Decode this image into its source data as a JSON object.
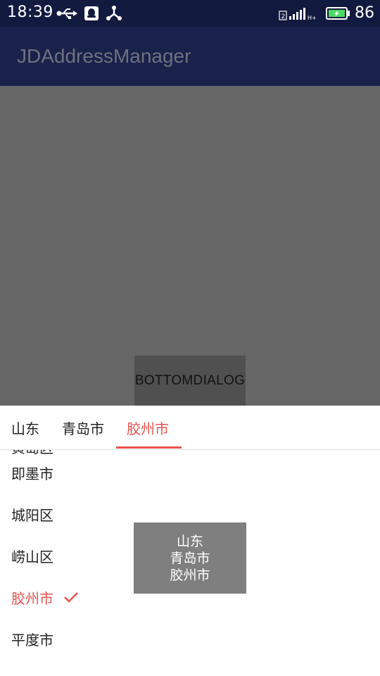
{
  "status_bar": {
    "time": "18:39",
    "battery_percent": "86",
    "icons": [
      "usb-icon",
      "qq-icon",
      "share-icon",
      "signal-icon",
      "battery-icon"
    ]
  },
  "app_bar": {
    "title": "JDAddressManager"
  },
  "main": {
    "bottom_dialog_button_label": "BOTTOMDIALOG"
  },
  "dialog": {
    "tabs": [
      {
        "label": "山东"
      },
      {
        "label": "青岛市"
      },
      {
        "label": "胶州市",
        "active": true
      }
    ],
    "list": [
      {
        "label": "黄岛区"
      },
      {
        "label": "即墨市"
      },
      {
        "label": "城阳区"
      },
      {
        "label": "崂山区"
      },
      {
        "label": "胶州市",
        "selected": true
      },
      {
        "label": "平度市"
      }
    ]
  },
  "toast": {
    "lines": [
      "山东",
      "青岛市",
      "胶州市"
    ]
  },
  "colors": {
    "accent": "#e8534f",
    "status_bar": "#121a3f",
    "app_bar_dimmed": "#1a214a",
    "overlay": "#666666"
  }
}
